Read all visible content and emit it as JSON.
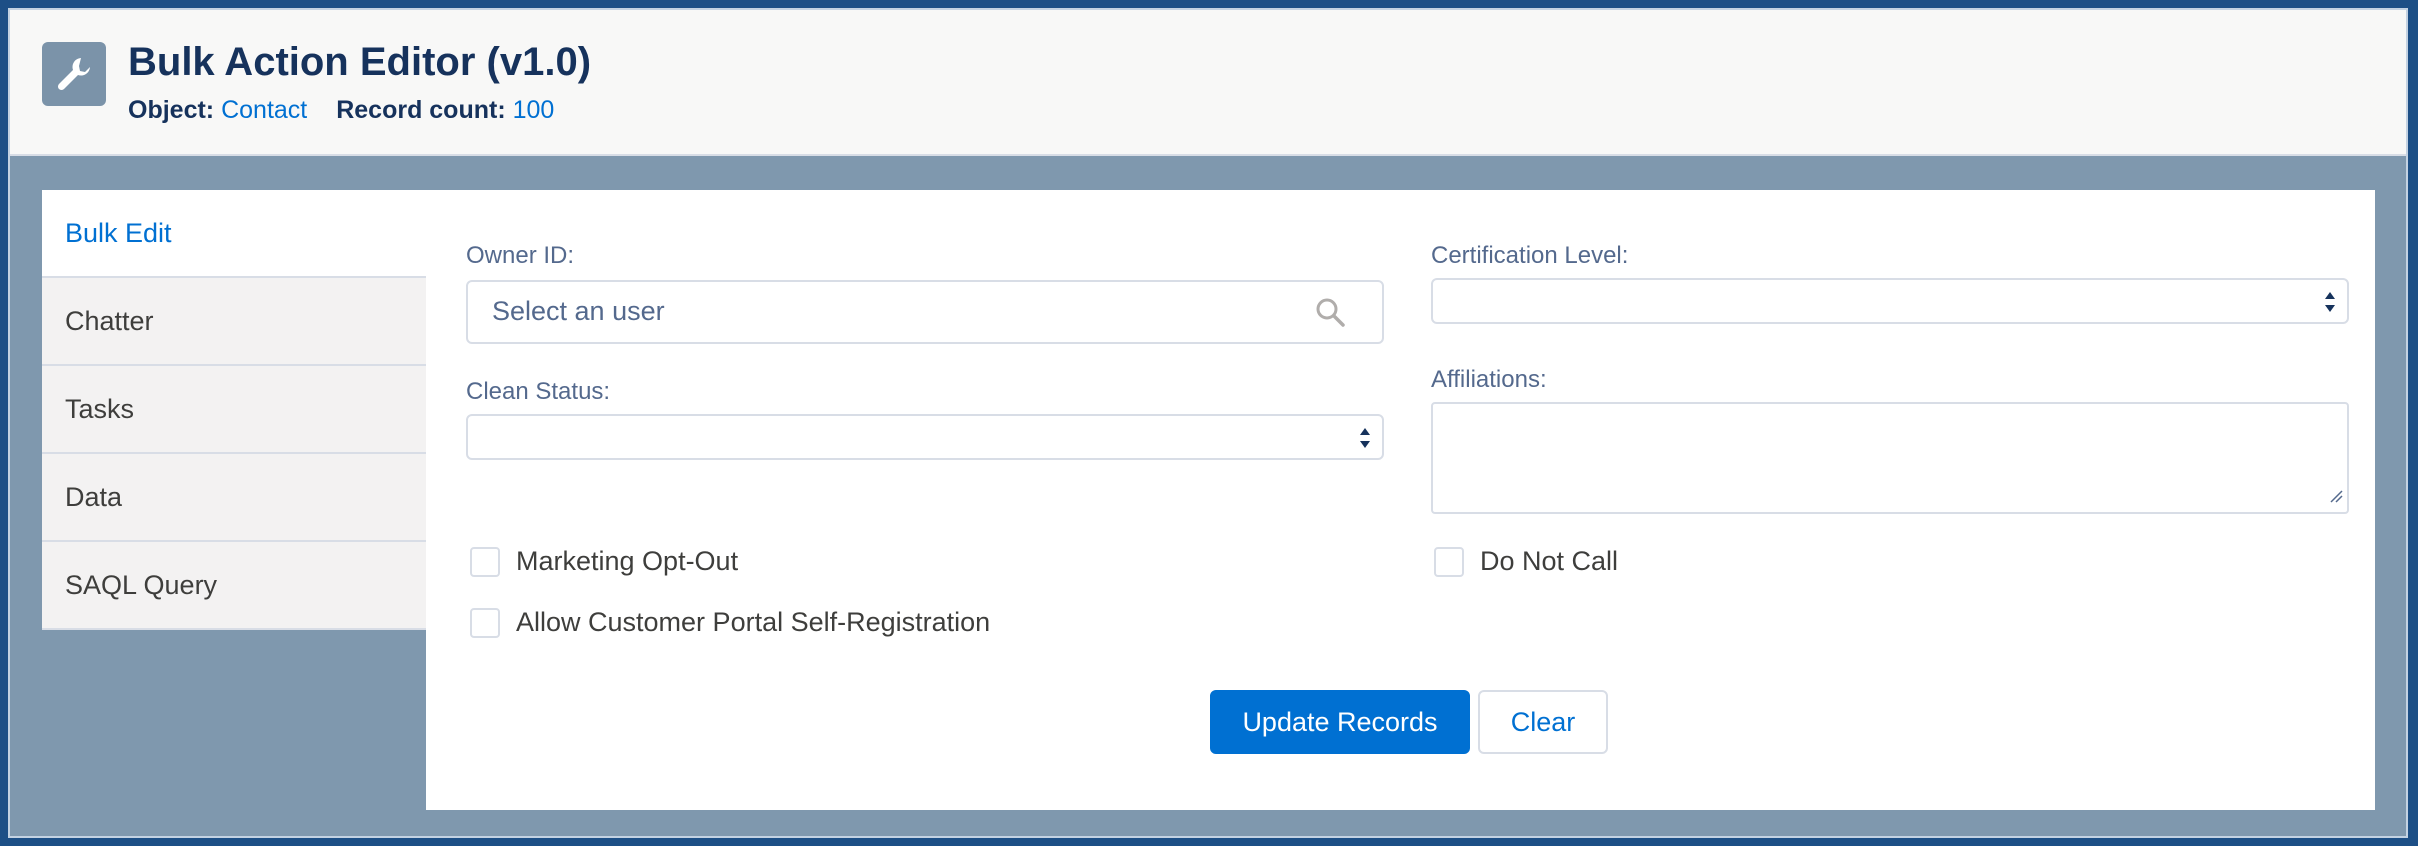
{
  "header": {
    "title": "Bulk Action Editor (v1.0)",
    "object_label": "Object:",
    "object_value": "Contact",
    "record_count_label": "Record count:",
    "record_count_value": "100",
    "icon": "wrench-icon"
  },
  "sidebar": {
    "items": [
      {
        "label": "Bulk Edit",
        "active": true
      },
      {
        "label": "Chatter",
        "active": false
      },
      {
        "label": "Tasks",
        "active": false
      },
      {
        "label": "Data",
        "active": false
      },
      {
        "label": "SAQL Query",
        "active": false
      }
    ]
  },
  "form": {
    "owner_id": {
      "label": "Owner ID:",
      "placeholder": "Select an user",
      "icon": "search-icon"
    },
    "clean_status": {
      "label": "Clean Status:",
      "value": ""
    },
    "certification_level": {
      "label": "Certification Level:",
      "value": ""
    },
    "affiliations": {
      "label": "Affiliations:",
      "value": ""
    },
    "checkboxes": {
      "marketing_opt_out": {
        "label": "Marketing Opt-Out",
        "checked": false
      },
      "allow_portal_self_registration": {
        "label": "Allow Customer Portal Self-Registration",
        "checked": false
      },
      "do_not_call": {
        "label": "Do Not Call",
        "checked": false
      }
    },
    "buttons": {
      "update": "Update Records",
      "clear": "Clear"
    }
  },
  "colors": {
    "accent": "#0070d2",
    "title": "#16325c",
    "background": "#7f98ae"
  }
}
